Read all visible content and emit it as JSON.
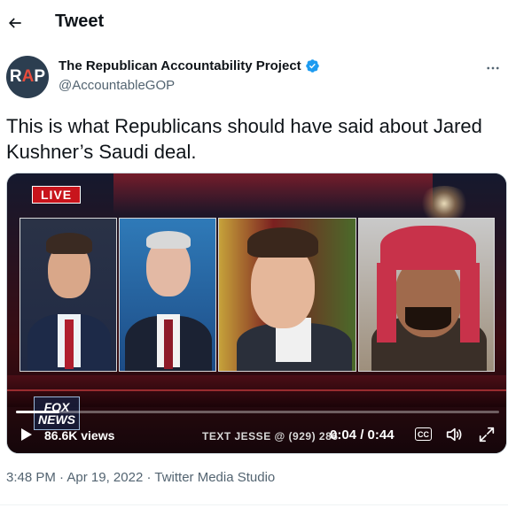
{
  "header": {
    "title": "Tweet"
  },
  "author": {
    "avatar_text": {
      "r": "R",
      "a": "A",
      "p": "P"
    },
    "display_name": "The Republican Accountability Project",
    "handle": "@AccountableGOP",
    "verified": true
  },
  "tweet": {
    "text": "This is what Republicans should have said about Jared Kushner’s Saudi deal."
  },
  "media": {
    "live_label": "LIVE",
    "logo_text": "FOX NEWS",
    "views": "86.6K views",
    "ticker_text": "TEXT JESSE @ (929) 286",
    "time": "0:04 / 0:44",
    "cc_label": "CC",
    "progress": 0.09
  },
  "meta": {
    "time": "3:48 PM",
    "separator1": " · ",
    "date": "Apr 19, 2022",
    "separator2": " · ",
    "source": "Twitter Media Studio"
  },
  "colors": {
    "text_primary": "#0f1419",
    "text_secondary": "#536471",
    "verified_blue": "#1d9bf0",
    "live_red": "#c8141c"
  },
  "icons": {
    "back": "arrow-left-icon",
    "verified": "verified-badge-icon",
    "more": "more-horizontal-icon",
    "play": "play-icon",
    "cc": "closed-captions-icon",
    "volume": "volume-icon",
    "fullscreen": "fullscreen-icon"
  }
}
